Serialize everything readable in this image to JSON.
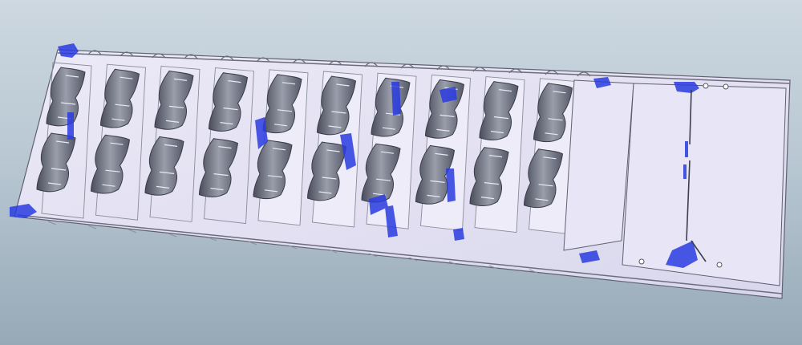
{
  "scene": {
    "subject": "progressive-die-strip-layout-3d",
    "station_count": 12,
    "part_rows_per_station": 2,
    "colors": {
      "background_top": "#cdd8e0",
      "background_bottom": "#97a9b7",
      "strip_fill": "#e6e4f4",
      "strip_edge": "#5f6170",
      "part_shade": "#5e6272",
      "cut_highlight": "#2a3be0"
    }
  }
}
